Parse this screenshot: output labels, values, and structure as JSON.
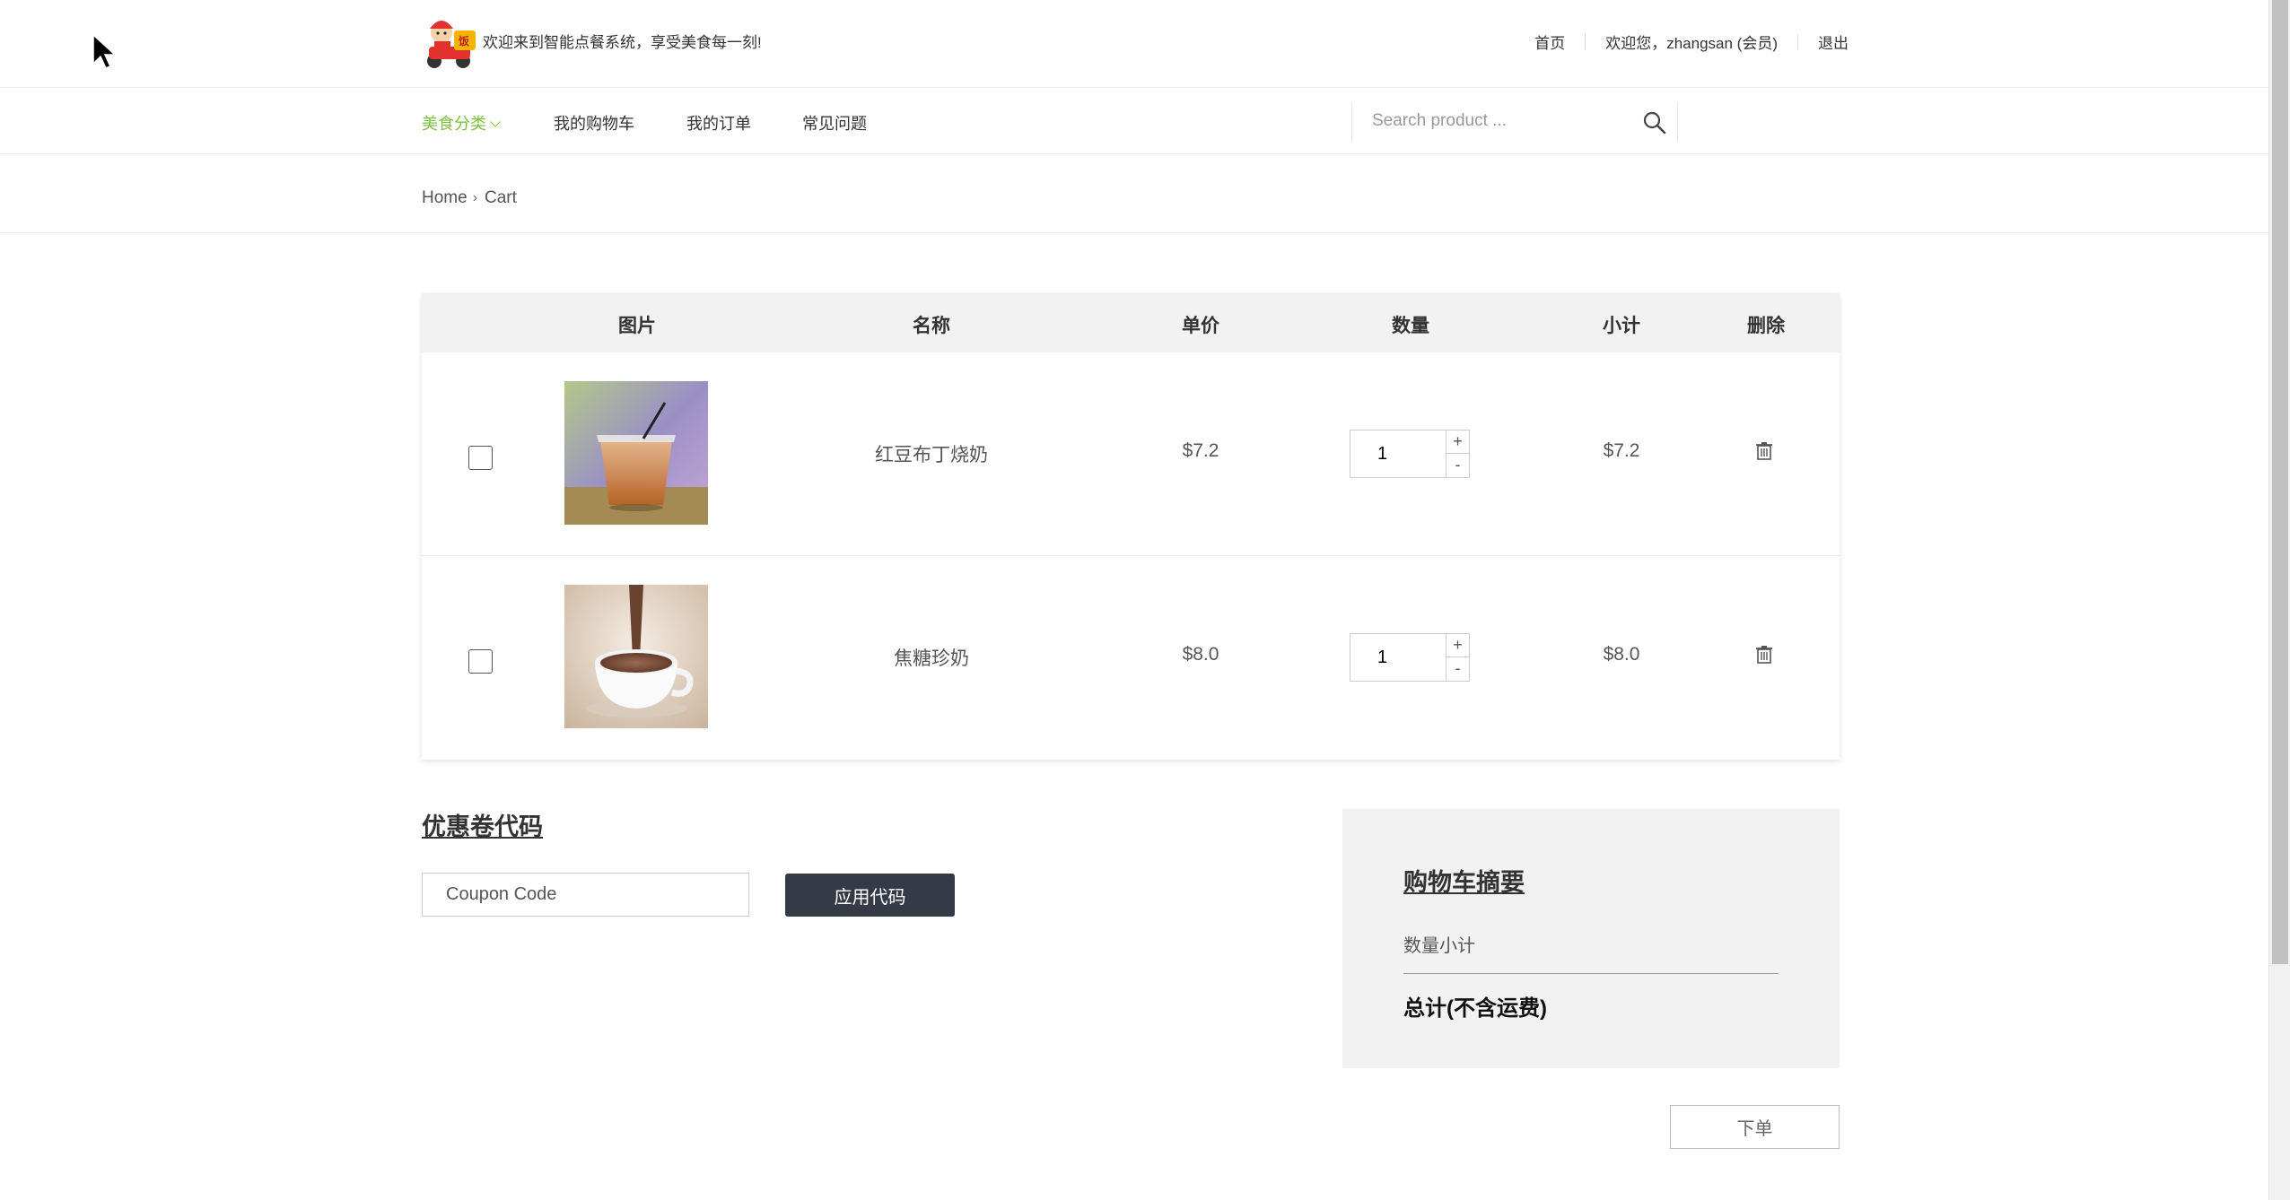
{
  "header": {
    "welcome_message": "欢迎来到智能点餐系统，享受美食每一刻!",
    "links": {
      "home": "首页",
      "user_greeting": "欢迎您，zhangsan (会员)",
      "logout": "退出"
    }
  },
  "nav": {
    "items": [
      {
        "label": "美食分类",
        "active": true
      },
      {
        "label": "我的购物车"
      },
      {
        "label": "我的订单"
      },
      {
        "label": "常见问题"
      }
    ],
    "search_placeholder": "Search product ..."
  },
  "breadcrumb": {
    "home": "Home",
    "current": "Cart"
  },
  "cart": {
    "columns": [
      "图片",
      "名称",
      "单价",
      "数量",
      "小计",
      "删除"
    ],
    "rows": [
      {
        "name": "红豆布丁烧奶",
        "price": "$7.2",
        "quantity": "1",
        "subtotal": "$7.2",
        "image": "iced-milk-tea-photo"
      },
      {
        "name": "焦糖珍奶",
        "price": "$8.0",
        "quantity": "1",
        "subtotal": "$8.0",
        "image": "hot-chocolate-cup-photo"
      }
    ],
    "plus_label": "+",
    "minus_label": "-"
  },
  "coupon": {
    "title": "优惠卷代码",
    "placeholder": "Coupon Code",
    "apply_label": "应用代码"
  },
  "summary": {
    "title": "购物车摘要",
    "quantity_subtotal_label": "数量小计",
    "total_label": "总计(不含运费)"
  },
  "order_button_label": "下单",
  "colors": {
    "accent_green": "#7dc142",
    "dark_button": "#343a46",
    "summary_bg": "#f2f2f2",
    "table_header_bg": "#f2f2f2"
  }
}
